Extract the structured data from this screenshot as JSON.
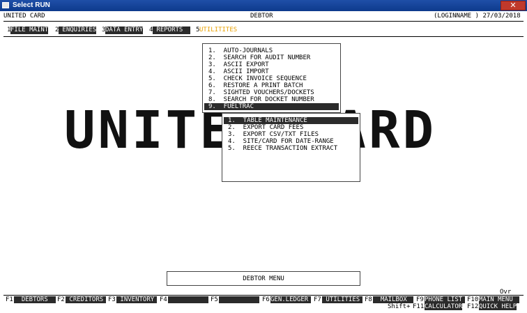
{
  "window": {
    "title": "Select RUN",
    "close_label": "✕"
  },
  "header": {
    "company": "UNITED CARD",
    "module": "DEBTOR",
    "login": "(LOGINNAME ) 27/03/2018"
  },
  "menubar": [
    {
      "num": "1",
      "label": "FILE MAINT"
    },
    {
      "num": "2",
      "label": " ENQUIRIES"
    },
    {
      "num": "3",
      "label": "DATA ENTRY"
    },
    {
      "num": "4",
      "label": " REPORTS  "
    },
    {
      "num": "5",
      "label": "UTILITITES"
    }
  ],
  "background_logo": "UNITED CARD",
  "utilities_menu": [
    "1.  AUTO-JOURNALS",
    "2.  SEARCH FOR AUDIT NUMBER",
    "3.  ASCII EXPORT",
    "4.  ASCII IMPORT",
    "5.  CHECK INVOICE SEQUENCE",
    "6.  RESTORE A PRINT BATCH",
    "7.  SIGHTED VOUCHERS/DOCKETS",
    "8.  SEARCH FOR DOCKET NUMBER",
    "9.  FUELTRAC"
  ],
  "fueltrac_menu": [
    "1.  TABLE MAINTENANCE",
    "2.  EXPORT CARD FEES",
    "3.  EXPORT CSV/TXT FILES",
    "4.  SITE/CARD FOR DATE-RANGE",
    "5.  REECE TRANSACTION EXTRACT"
  ],
  "status_box": "DEBTOR MENU",
  "ovr": "Ovr",
  "fkeys": [
    {
      "key": "F1",
      "label": "  DEBTORS  "
    },
    {
      "key": "F2",
      "label": " CREDITORS"
    },
    {
      "key": "F3",
      "label": " INVENTORY"
    },
    {
      "key": "F4",
      "label": "          "
    },
    {
      "key": "F5",
      "label": "          "
    },
    {
      "key": "F6",
      "label": "GEN.LEDGER"
    },
    {
      "key": "F7",
      "label": " UTILITIES"
    },
    {
      "key": "F8",
      "label": "  MAILBOX "
    },
    {
      "key": "F9",
      "label": "PHONE LIST"
    },
    {
      "key": "F10",
      "label": "MAIN MENU"
    }
  ],
  "shift_label": "Shift+",
  "shift_fkeys": [
    {
      "key": "F11",
      "label": "CALCULATOR"
    },
    {
      "key": "F12",
      "label": "QUICK HELP"
    }
  ]
}
